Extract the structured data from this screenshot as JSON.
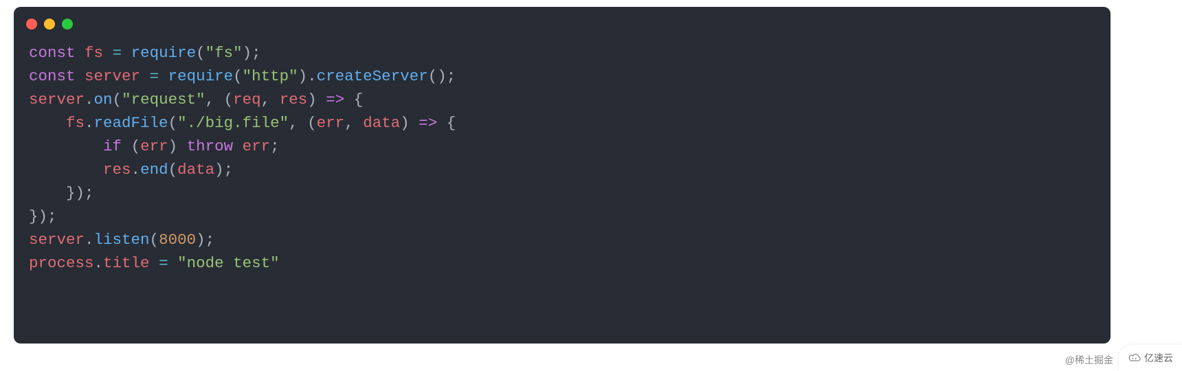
{
  "watermark": {
    "credit": "@稀土掘金",
    "badge_text": "亿速云"
  },
  "code": {
    "tokens": [
      [
        {
          "t": "keyword",
          "v": "const"
        },
        {
          "t": "plain",
          "v": " "
        },
        {
          "t": "varname",
          "v": "fs"
        },
        {
          "t": "plain",
          "v": " "
        },
        {
          "t": "operator",
          "v": "="
        },
        {
          "t": "plain",
          "v": " "
        },
        {
          "t": "func",
          "v": "require"
        },
        {
          "t": "punct",
          "v": "("
        },
        {
          "t": "string",
          "v": "\"fs\""
        },
        {
          "t": "punct",
          "v": ")"
        },
        {
          "t": "punct",
          "v": ";"
        }
      ],
      [
        {
          "t": "keyword",
          "v": "const"
        },
        {
          "t": "plain",
          "v": " "
        },
        {
          "t": "varname",
          "v": "server"
        },
        {
          "t": "plain",
          "v": " "
        },
        {
          "t": "operator",
          "v": "="
        },
        {
          "t": "plain",
          "v": " "
        },
        {
          "t": "func",
          "v": "require"
        },
        {
          "t": "punct",
          "v": "("
        },
        {
          "t": "string",
          "v": "\"http\""
        },
        {
          "t": "punct",
          "v": ")"
        },
        {
          "t": "punct",
          "v": "."
        },
        {
          "t": "func",
          "v": "createServer"
        },
        {
          "t": "punct",
          "v": "("
        },
        {
          "t": "punct",
          "v": ")"
        },
        {
          "t": "punct",
          "v": ";"
        }
      ],
      [
        {
          "t": "varname",
          "v": "server"
        },
        {
          "t": "punct",
          "v": "."
        },
        {
          "t": "func",
          "v": "on"
        },
        {
          "t": "punct",
          "v": "("
        },
        {
          "t": "string",
          "v": "\"request\""
        },
        {
          "t": "punct",
          "v": ","
        },
        {
          "t": "plain",
          "v": " "
        },
        {
          "t": "punct",
          "v": "("
        },
        {
          "t": "varname",
          "v": "req"
        },
        {
          "t": "punct",
          "v": ","
        },
        {
          "t": "plain",
          "v": " "
        },
        {
          "t": "varname",
          "v": "res"
        },
        {
          "t": "punct",
          "v": ")"
        },
        {
          "t": "plain",
          "v": " "
        },
        {
          "t": "keyword",
          "v": "=>"
        },
        {
          "t": "plain",
          "v": " "
        },
        {
          "t": "punct",
          "v": "{"
        }
      ],
      [
        {
          "t": "plain",
          "v": "    "
        },
        {
          "t": "varname",
          "v": "fs"
        },
        {
          "t": "punct",
          "v": "."
        },
        {
          "t": "func",
          "v": "readFile"
        },
        {
          "t": "punct",
          "v": "("
        },
        {
          "t": "string",
          "v": "\"./big.file\""
        },
        {
          "t": "punct",
          "v": ","
        },
        {
          "t": "plain",
          "v": " "
        },
        {
          "t": "punct",
          "v": "("
        },
        {
          "t": "varname",
          "v": "err"
        },
        {
          "t": "punct",
          "v": ","
        },
        {
          "t": "plain",
          "v": " "
        },
        {
          "t": "varname",
          "v": "data"
        },
        {
          "t": "punct",
          "v": ")"
        },
        {
          "t": "plain",
          "v": " "
        },
        {
          "t": "keyword",
          "v": "=>"
        },
        {
          "t": "plain",
          "v": " "
        },
        {
          "t": "punct",
          "v": "{"
        }
      ],
      [
        {
          "t": "plain",
          "v": "        "
        },
        {
          "t": "keyword",
          "v": "if"
        },
        {
          "t": "plain",
          "v": " "
        },
        {
          "t": "punct",
          "v": "("
        },
        {
          "t": "varname",
          "v": "err"
        },
        {
          "t": "punct",
          "v": ")"
        },
        {
          "t": "plain",
          "v": " "
        },
        {
          "t": "keyword",
          "v": "throw"
        },
        {
          "t": "plain",
          "v": " "
        },
        {
          "t": "varname",
          "v": "err"
        },
        {
          "t": "punct",
          "v": ";"
        }
      ],
      [
        {
          "t": "plain",
          "v": "        "
        },
        {
          "t": "varname",
          "v": "res"
        },
        {
          "t": "punct",
          "v": "."
        },
        {
          "t": "func",
          "v": "end"
        },
        {
          "t": "punct",
          "v": "("
        },
        {
          "t": "varname",
          "v": "data"
        },
        {
          "t": "punct",
          "v": ")"
        },
        {
          "t": "punct",
          "v": ";"
        }
      ],
      [
        {
          "t": "plain",
          "v": "    "
        },
        {
          "t": "punct",
          "v": "}"
        },
        {
          "t": "punct",
          "v": ")"
        },
        {
          "t": "punct",
          "v": ";"
        }
      ],
      [
        {
          "t": "punct",
          "v": "}"
        },
        {
          "t": "punct",
          "v": ")"
        },
        {
          "t": "punct",
          "v": ";"
        }
      ],
      [
        {
          "t": "varname",
          "v": "server"
        },
        {
          "t": "punct",
          "v": "."
        },
        {
          "t": "func",
          "v": "listen"
        },
        {
          "t": "punct",
          "v": "("
        },
        {
          "t": "num",
          "v": "8000"
        },
        {
          "t": "punct",
          "v": ")"
        },
        {
          "t": "punct",
          "v": ";"
        }
      ],
      [
        {
          "t": "varname",
          "v": "process"
        },
        {
          "t": "punct",
          "v": "."
        },
        {
          "t": "varname",
          "v": "title"
        },
        {
          "t": "plain",
          "v": " "
        },
        {
          "t": "operator",
          "v": "="
        },
        {
          "t": "plain",
          "v": " "
        },
        {
          "t": "string",
          "v": "\"node test\""
        }
      ]
    ]
  }
}
